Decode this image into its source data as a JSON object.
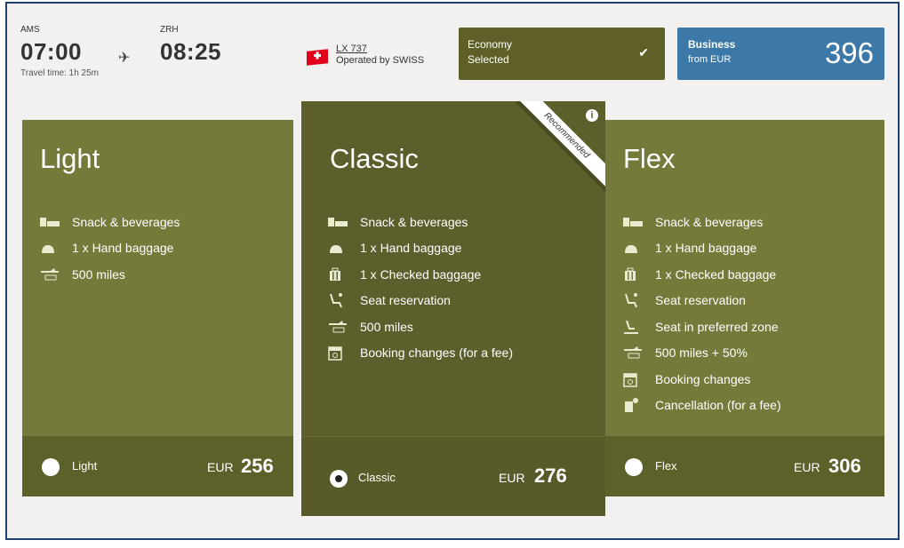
{
  "flight": {
    "origin_code": "AMS",
    "depart_time": "07:00",
    "dest_code": "ZRH",
    "arrive_time": "08:25",
    "travel_time": "Travel time: 1h 25m",
    "flight_number": "LX 737",
    "operator": "Operated by SWISS"
  },
  "cabins": {
    "economy": {
      "line1": "Economy",
      "line2": "Selected",
      "checked_icon": "check-icon"
    },
    "business": {
      "line1": "Business",
      "line2": "from EUR",
      "price": "396"
    }
  },
  "fares": [
    {
      "name": "Light",
      "features": [
        {
          "icon": "meal-icon",
          "text": "Snack & beverages"
        },
        {
          "icon": "hand-baggage-icon",
          "text": "1 x Hand baggage"
        },
        {
          "icon": "miles-icon",
          "text": "500 miles"
        }
      ],
      "radio_label": "Light",
      "currency": "EUR",
      "price": "256",
      "selected": false
    },
    {
      "name": "Classic",
      "badge": "Recommended",
      "features": [
        {
          "icon": "meal-icon",
          "text": "Snack & beverages"
        },
        {
          "icon": "hand-baggage-icon",
          "text": "1 x Hand baggage"
        },
        {
          "icon": "checked-baggage-icon",
          "text": "1 x Checked baggage"
        },
        {
          "icon": "seat-icon",
          "text": "Seat reservation"
        },
        {
          "icon": "miles-icon",
          "text": "500 miles"
        },
        {
          "icon": "calendar-icon",
          "text": "Booking changes (for a fee)"
        }
      ],
      "radio_label": "Classic",
      "currency": "EUR",
      "price": "276",
      "selected": true
    },
    {
      "name": "Flex",
      "features": [
        {
          "icon": "meal-icon",
          "text": "Snack & beverages"
        },
        {
          "icon": "hand-baggage-icon",
          "text": "1 x Hand baggage"
        },
        {
          "icon": "checked-baggage-icon",
          "text": "1 x Checked baggage"
        },
        {
          "icon": "seat-icon",
          "text": "Seat reservation"
        },
        {
          "icon": "preferred-seat-icon",
          "text": "Seat in preferred zone"
        },
        {
          "icon": "miles-icon",
          "text": "500 miles + 50%"
        },
        {
          "icon": "calendar-icon",
          "text": "Booking changes"
        },
        {
          "icon": "cancellation-icon",
          "text": "Cancellation (for a fee)"
        }
      ],
      "radio_label": "Flex",
      "currency": "EUR",
      "price": "306",
      "selected": false
    }
  ],
  "colors": {
    "frame_border": "#1f3f6e",
    "economy_bg": "#5e6028",
    "business_bg": "#3c79a8",
    "card_bg": "#757a3b",
    "card_selected_bg": "#5c5e2c"
  }
}
